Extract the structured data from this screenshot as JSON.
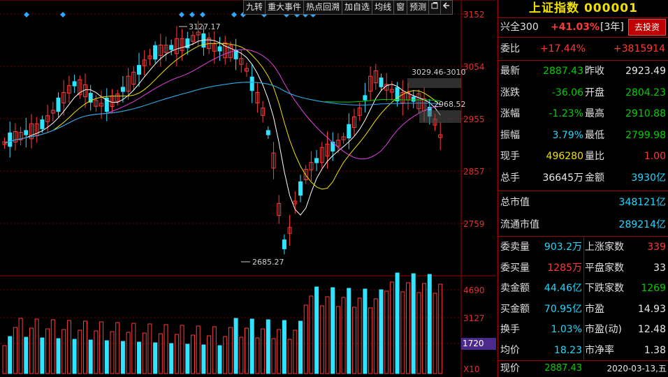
{
  "toolbar": {
    "buttons": [
      "九转",
      "重大事件",
      "热点回溯",
      "加自选",
      "均线",
      "窗",
      "预测"
    ],
    "icons": [
      "restore-window-icon",
      "back-arrow-icon"
    ]
  },
  "chart_labels": {
    "price_ticks": [
      "3152",
      "3054",
      "2955",
      "2857",
      "2759"
    ],
    "volume_ticks": [
      "4690",
      "3127"
    ],
    "volume_highlight": "1720",
    "multiplier": "X10",
    "annotations": {
      "high": "3127.17",
      "low": "2685.27",
      "range": "3029.46-3010",
      "level": "2968.52"
    }
  },
  "chart_data": {
    "type": "candlestick",
    "price_axis": {
      "ticks": [
        3152,
        3054,
        2955,
        2857,
        2759
      ]
    },
    "volume_axis": {
      "ticks": [
        4690,
        3127,
        1720
      ],
      "unit_multiplier": "X10"
    },
    "grid": true
  },
  "colors": {
    "up": "#ff3b3b",
    "down": "#30e4ff",
    "ma5": "#ffffff",
    "ma10": "#f0e000",
    "ma20": "#e040e0",
    "ma60": "#00d000",
    "ma120": "#30a0ff",
    "panel_border": "#a00000",
    "title": "#f0e000"
  },
  "panel": {
    "title": "上证指数 000001",
    "xq300": {
      "label": "兴全300",
      "value": "+41.03%",
      "period": "[3年]",
      "button": "去投资"
    },
    "weibi": {
      "label": "委比",
      "pct": "+17.44%",
      "value": "+3815914"
    },
    "quote": [
      {
        "l1": "最新",
        "v1": "2887.43",
        "c1": "green",
        "l2": "昨收",
        "v2": "2923.49",
        "c2": "white"
      },
      {
        "l1": "涨跌",
        "v1": "-36.06",
        "c1": "green",
        "l2": "开盘",
        "v2": "2804.23",
        "c2": "green"
      },
      {
        "l1": "涨幅",
        "v1": "-1.23%",
        "c1": "green",
        "l2": "最高",
        "v2": "2910.88",
        "c2": "green"
      },
      {
        "l1": "振幅",
        "v1": "3.79%",
        "c1": "cyan",
        "l2": "最低",
        "v2": "2799.98",
        "c2": "green"
      },
      {
        "l1": "现手",
        "v1": "496280",
        "c1": "yellow",
        "l2": "量比",
        "v2": "1.00",
        "c2": "red"
      },
      {
        "l1": "总手",
        "v1": "36645万",
        "c1": "white",
        "l2": "金额",
        "v2": "3930亿",
        "c2": "cyan"
      }
    ],
    "market": [
      {
        "label": "总市值",
        "value": "348121亿"
      },
      {
        "label": "流通市值",
        "value": "289214亿"
      }
    ],
    "trade": [
      {
        "l1": "委卖量",
        "v1": "903.2万",
        "c1": "cyan",
        "l2": "上涨家数",
        "v2": "339",
        "c2": "red"
      },
      {
        "l1": "委买量",
        "v1": "1285万",
        "c1": "red",
        "l2": "平盘家数",
        "v2": "33",
        "c2": "white"
      },
      {
        "l1": "卖金额",
        "v1": "44.46亿",
        "c1": "cyan",
        "l2": "下跌家数",
        "v2": "1269",
        "c2": "green"
      },
      {
        "l1": "买金额",
        "v1": "70.95亿",
        "c1": "cyan",
        "l2": "市盈",
        "v2": "14.93",
        "c2": "white"
      },
      {
        "l1": "换手",
        "v1": "1.03%",
        "c1": "cyan",
        "l2": "市盈(动)",
        "v2": "12.48",
        "c2": "white"
      },
      {
        "l1": "均价",
        "v1": "18.23",
        "c1": "cyan",
        "l2": "市净率",
        "v2": "1.38",
        "c2": "white"
      }
    ],
    "footer": {
      "label": "现价",
      "price": "2887.43",
      "date": "2020-03-13,五"
    }
  }
}
